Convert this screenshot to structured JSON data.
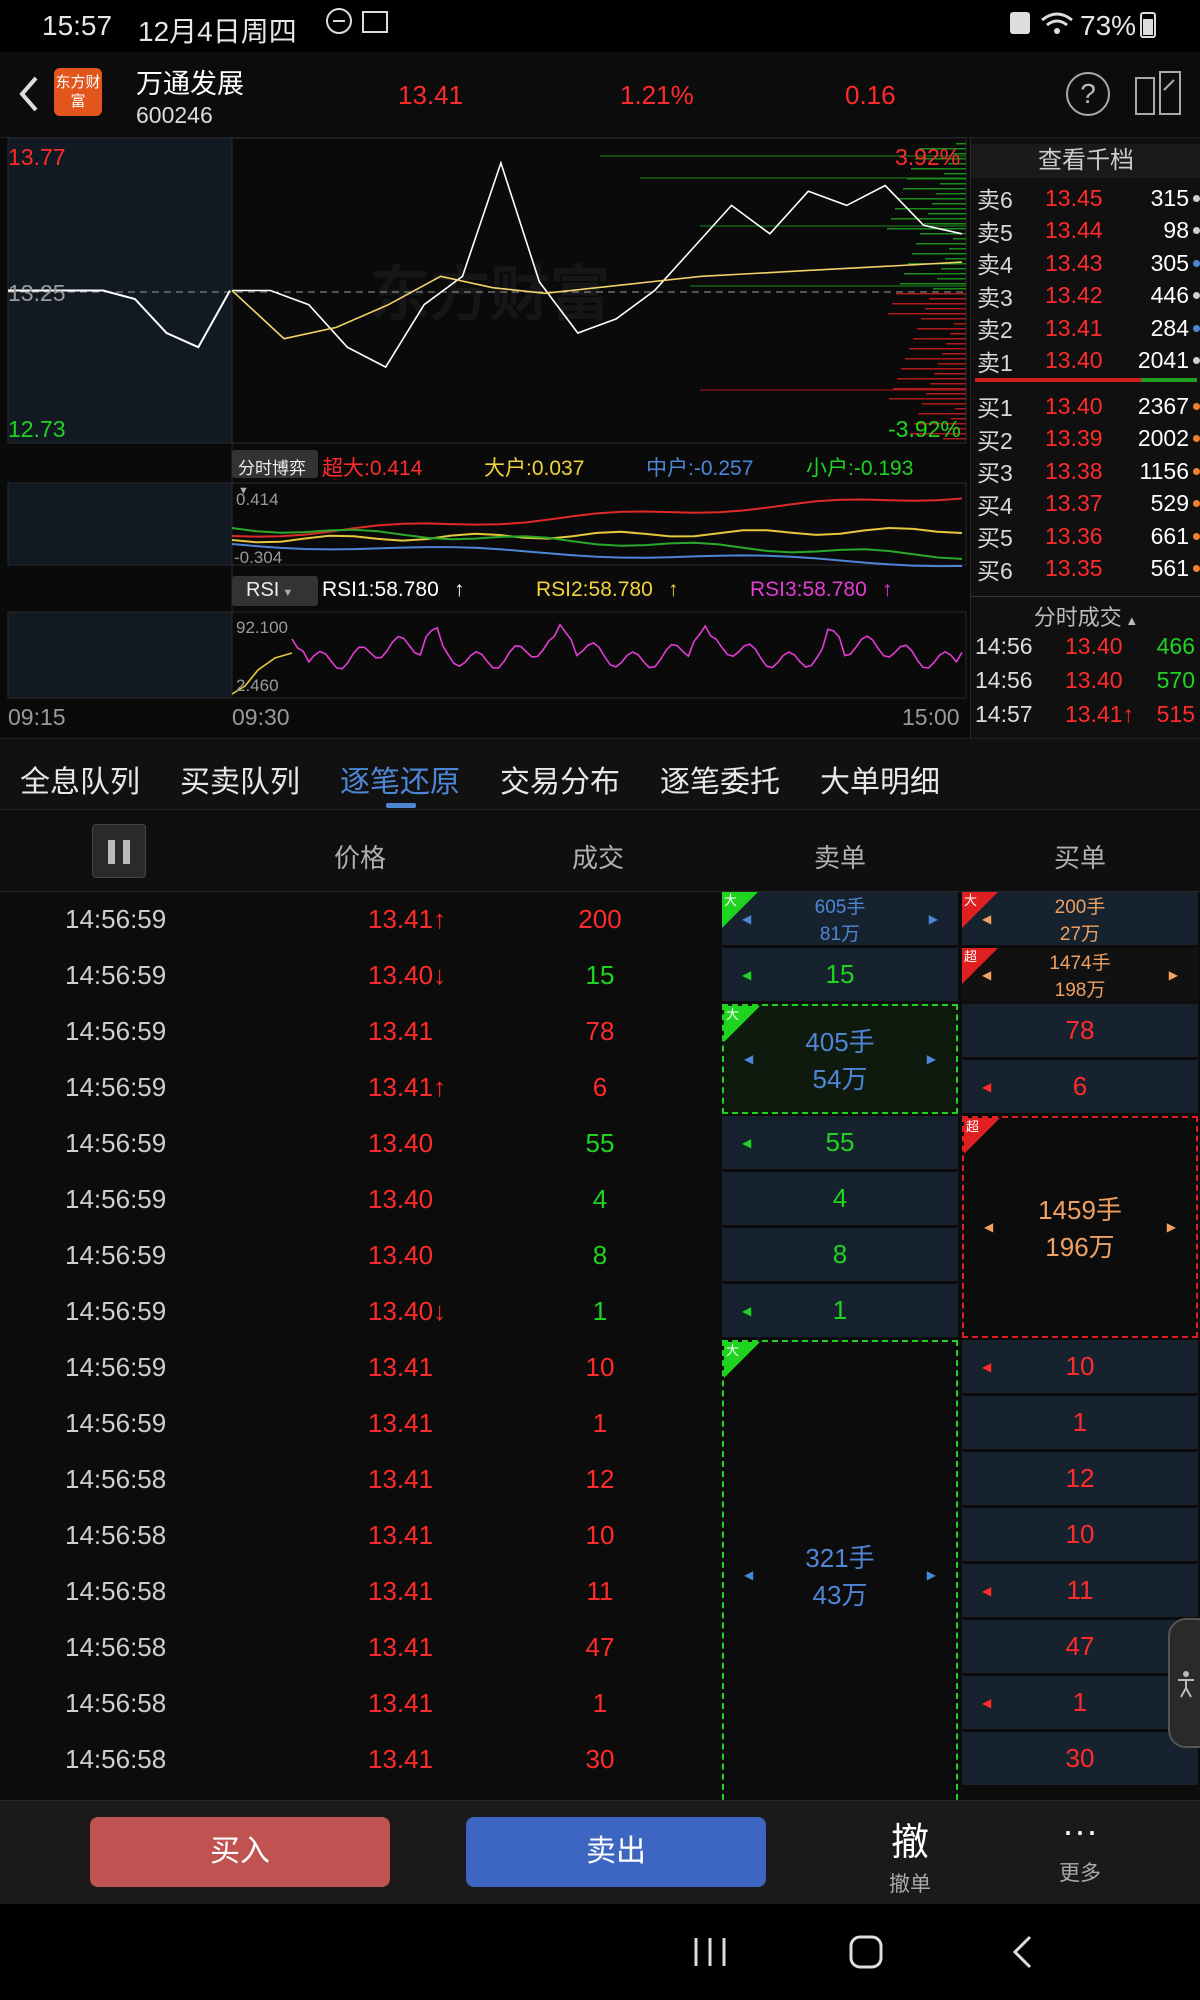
{
  "status_bar": {
    "time": "15:57",
    "date": "12月4日周四",
    "battery": "73%"
  },
  "header": {
    "logo_text": "东方财富",
    "stock_name": "万通发展",
    "stock_code": "600246",
    "price": "13.41",
    "change_pct": "1.21%",
    "change": "0.16"
  },
  "chart": {
    "price_high": "13.77",
    "price_mid": "13.25",
    "price_low": "12.73",
    "pct_high": "3.92%",
    "pct_low": "-3.92%",
    "watermark": "东方财富",
    "time_start": "09:15",
    "time_open": "09:30",
    "time_end": "15:00",
    "flow_selector": "分时博弈",
    "flow_super": "超大:0.414",
    "flow_large": "大户:0.037",
    "flow_mid": "中户:-0.257",
    "flow_small": "小户:-0.193",
    "flow_top": "0.414",
    "flow_bottom": "-0.304",
    "rsi_selector": "RSI",
    "rsi1": "RSI1:58.780",
    "rsi2": "RSI2:58.780",
    "rsi3": "RSI3:58.780",
    "rsi_top": "92.100",
    "rsi_bottom": "2.460"
  },
  "chart_data": {
    "type": "line",
    "title": "",
    "x_range": [
      "09:15",
      "15:00"
    ],
    "ylim": [
      12.73,
      13.77
    ],
    "prev_close": 13.25,
    "series": [
      {
        "values": [
          13.25,
          13.25,
          13.2,
          13.05,
          12.98,
          13.2,
          13.3,
          13.7,
          13.28,
          13.1,
          13.15,
          13.25,
          13.4,
          13.55,
          13.45,
          13.6,
          13.55,
          13.62,
          13.48,
          13.45
        ]
      },
      {
        "values": [
          13.25,
          13.08,
          13.12,
          13.2,
          13.3,
          13.26,
          13.24,
          13.26,
          13.28,
          13.3,
          13.31,
          13.32,
          13.33,
          13.34,
          13.35
        ]
      }
    ]
  },
  "orderbook": {
    "title": "查看千档",
    "asks": [
      {
        "label": "卖6",
        "price": "13.45",
        "vol": "315",
        "dot": "#cfcfcf"
      },
      {
        "label": "卖5",
        "price": "13.44",
        "vol": "98",
        "dot": "#cfcfcf"
      },
      {
        "label": "卖4",
        "price": "13.43",
        "vol": "305",
        "dot": "#4e86d6"
      },
      {
        "label": "卖3",
        "price": "13.42",
        "vol": "446",
        "dot": "#cfcfcf"
      },
      {
        "label": "卖2",
        "price": "13.41",
        "vol": "284",
        "dot": "#4e86d6"
      },
      {
        "label": "卖1",
        "price": "13.40",
        "vol": "2041",
        "dot": "#cfcfcf"
      }
    ],
    "bids": [
      {
        "label": "买1",
        "price": "13.40",
        "vol": "2367",
        "dot": "#f08030"
      },
      {
        "label": "买2",
        "price": "13.39",
        "vol": "2002",
        "dot": "#f08030"
      },
      {
        "label": "买3",
        "price": "13.38",
        "vol": "1156",
        "dot": "#f08030"
      },
      {
        "label": "买4",
        "price": "13.37",
        "vol": "529",
        "dot": "#f08030"
      },
      {
        "label": "买5",
        "price": "13.36",
        "vol": "661",
        "dot": "#f08030"
      },
      {
        "label": "买6",
        "price": "13.35",
        "vol": "561",
        "dot": "#f08030"
      }
    ],
    "ticks_title": "分时成交",
    "ticks": [
      {
        "time": "14:56",
        "price": "13.40",
        "vol": "466",
        "pcolor": "#ff2b2b",
        "vcolor": "#1fd41f"
      },
      {
        "time": "14:56",
        "price": "13.40",
        "vol": "570",
        "pcolor": "#ff2b2b",
        "vcolor": "#1fd41f"
      },
      {
        "time": "14:57",
        "price": "13.41↑",
        "vol": "515",
        "pcolor": "#ff2b2b",
        "vcolor": "#ff2b2b"
      }
    ]
  },
  "tabs": [
    "全息队列",
    "买卖队列",
    "逐笔还原",
    "交易分布",
    "逐笔委托",
    "大单明细"
  ],
  "table": {
    "col_price": "价格",
    "col_volume": "成交",
    "col_sell": "卖单",
    "col_buy": "买单",
    "rows": [
      {
        "time": "14:56:59",
        "price": "13.41↑",
        "vol": "200",
        "pc": "red",
        "vc": "red"
      },
      {
        "time": "14:56:59",
        "price": "13.40↓",
        "vol": "15",
        "pc": "red",
        "vc": "green"
      },
      {
        "time": "14:56:59",
        "price": "13.41",
        "vol": "78",
        "pc": "red",
        "vc": "red"
      },
      {
        "time": "14:56:59",
        "price": "13.41↑",
        "vol": "6",
        "pc": "red",
        "vc": "red"
      },
      {
        "time": "14:56:59",
        "price": "13.40",
        "vol": "55",
        "pc": "red",
        "vc": "green"
      },
      {
        "time": "14:56:59",
        "price": "13.40",
        "vol": "4",
        "pc": "red",
        "vc": "green"
      },
      {
        "time": "14:56:59",
        "price": "13.40",
        "vol": "8",
        "pc": "red",
        "vc": "green"
      },
      {
        "time": "14:56:59",
        "price": "13.40↓",
        "vol": "1",
        "pc": "red",
        "vc": "green"
      },
      {
        "time": "14:56:59",
        "price": "13.41",
        "vol": "10",
        "pc": "red",
        "vc": "red"
      },
      {
        "time": "14:56:59",
        "price": "13.41",
        "vol": "1",
        "pc": "red",
        "vc": "red"
      },
      {
        "time": "14:56:58",
        "price": "13.41",
        "vol": "12",
        "pc": "red",
        "vc": "red"
      },
      {
        "time": "14:56:58",
        "price": "13.41",
        "vol": "10",
        "pc": "red",
        "vc": "red"
      },
      {
        "time": "14:56:58",
        "price": "13.41",
        "vol": "11",
        "pc": "red",
        "vc": "red"
      },
      {
        "time": "14:56:58",
        "price": "13.41",
        "vol": "47",
        "pc": "red",
        "vc": "red"
      },
      {
        "time": "14:56:58",
        "price": "13.41",
        "vol": "1",
        "pc": "red",
        "vc": "red"
      },
      {
        "time": "14:56:58",
        "price": "13.41",
        "vol": "30",
        "pc": "red",
        "vc": "red"
      }
    ],
    "sell_orders": {
      "o1_a": "605手",
      "o1_b": "81万",
      "o2": "15",
      "o3_a": "405手",
      "o3_b": "54万",
      "o4": "55",
      "o5": "4",
      "o6": "8",
      "o7": "1",
      "o8_a": "321手",
      "o8_b": "43万"
    },
    "buy_orders": {
      "b1_a": "200手",
      "b1_b": "27万",
      "b2_a": "1474手",
      "b2_b": "198万",
      "b3": "78",
      "b4": "6",
      "b5_a": "1459手",
      "b5_b": "196万",
      "b6": "10",
      "b7": "1",
      "b8": "12",
      "b9": "10",
      "b10": "11",
      "b11": "47",
      "b12": "1",
      "b13": "30"
    },
    "badge_big": "大",
    "badge_super": "超"
  },
  "bottom": {
    "buy": "买入",
    "sell": "卖出",
    "cancel_icon": "撤",
    "cancel": "撤单",
    "more": "更多"
  }
}
